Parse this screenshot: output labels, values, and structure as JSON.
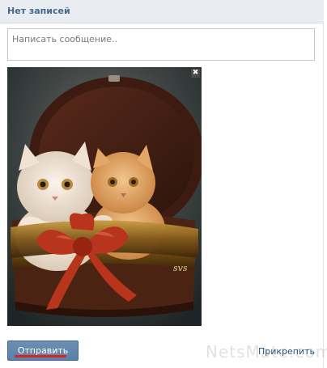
{
  "header": {
    "title": "Нет записей"
  },
  "composer": {
    "placeholder": "Написать сообщение.."
  },
  "attachment": {
    "remove_glyph": "✖",
    "signature": "svs"
  },
  "actions": {
    "send_label": "Отправить",
    "attach_label": "Прикрепить"
  },
  "watermark": {
    "text": "NetsMate.com"
  }
}
